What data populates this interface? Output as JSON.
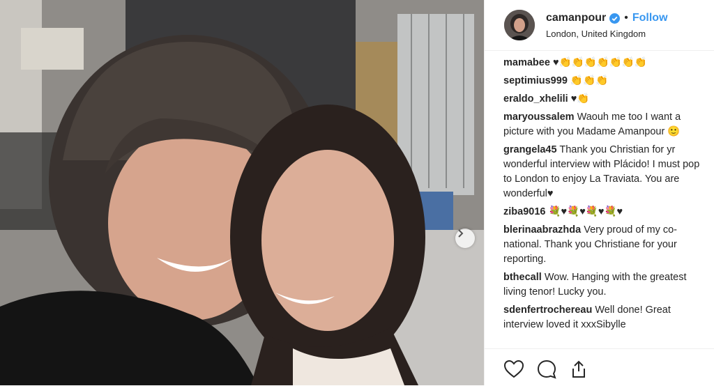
{
  "post": {
    "username": "camanpour",
    "separator": "•",
    "follow_label": "Follow",
    "location": "London, United Kingdom",
    "verified": true,
    "accent_color": "#3897f0"
  },
  "comments": [
    {
      "user": "mamabee",
      "text": "♥👏👏👏👏👏👏👏"
    },
    {
      "user": "septimius999",
      "text": "👏👏👏"
    },
    {
      "user": "eraldo_xhelili",
      "text": "♥👏"
    },
    {
      "user": "maryoussalem",
      "text": "Waouh me too I want a picture with you Madame Amanpour 🙂"
    },
    {
      "user": "grangela45",
      "text": "Thank you Christian for yr wonderful interview with Plácido! I must pop to London to enjoy La Traviata. You are wonderful♥"
    },
    {
      "user": "ziba9016",
      "text": "💐♥💐♥💐♥💐♥"
    },
    {
      "user": "blerinaabrazhda",
      "text": "Very proud of my co-national. Thank you Christiane for your reporting."
    },
    {
      "user": "bthecall",
      "text": "Wow. Hanging with the greatest living tenor! Lucky you."
    },
    {
      "user": "sdenfertrochereau",
      "text": "Well done! Great interview loved it xxxSibylle"
    }
  ],
  "icons": {
    "like": "heart-icon",
    "comment": "comment-icon",
    "share": "share-icon",
    "next": "chevron-right-icon"
  }
}
